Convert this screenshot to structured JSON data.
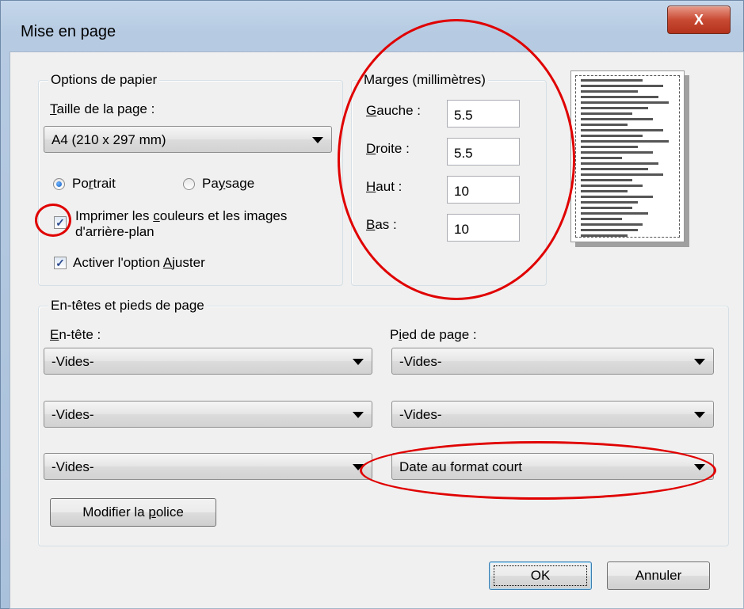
{
  "window": {
    "title": "Mise en page",
    "close_glyph": "X"
  },
  "paper": {
    "legend": "Options de papier",
    "size_label_u": "T",
    "size_label_rest": "aille de la page :",
    "size_value": "A4 (210 x 297 mm)",
    "portrait_label_a": "Po",
    "portrait_label_u": "r",
    "portrait_label_b": "trait",
    "landscape_label_a": "Pa",
    "landscape_label_u": "y",
    "landscape_label_b": "sage",
    "orientation": "portrait",
    "print_bg_line1_a": "Imprimer les ",
    "print_bg_line1_u": "c",
    "print_bg_line1_b": "ouleurs et les images",
    "print_bg_line2": "d'arrière-plan",
    "print_bg_checked": true,
    "shrink_label_a": "Activer l'option ",
    "shrink_label_u": "A",
    "shrink_label_b": "juster",
    "shrink_checked": true
  },
  "margins": {
    "legend": "Marges (millimètres)",
    "left_u": "G",
    "left_rest": "auche :",
    "left_value": "5.5",
    "right_u": "D",
    "right_rest": "roite :",
    "right_value": "5.5",
    "top_u": "H",
    "top_rest": "aut :",
    "top_value": "10",
    "bottom_u": "B",
    "bottom_rest": "as :",
    "bottom_value": "10"
  },
  "headers_footers": {
    "legend": "En-têtes et pieds de page",
    "header_label_u": "E",
    "header_label_rest": "n-tête :",
    "footer_label_a": "P",
    "footer_label_u": "i",
    "footer_label_b": "ed de page :",
    "header_values": [
      "-Vides-",
      "-Vides-",
      "-Vides-"
    ],
    "footer_values": [
      "-Vides-",
      "-Vides-",
      "Date au format court"
    ],
    "font_button_a": "Modifier la ",
    "font_button_u": "p",
    "font_button_b": "olice"
  },
  "buttons": {
    "ok": "OK",
    "cancel": "Annuler"
  },
  "annotations": {
    "color": "#e00000"
  }
}
